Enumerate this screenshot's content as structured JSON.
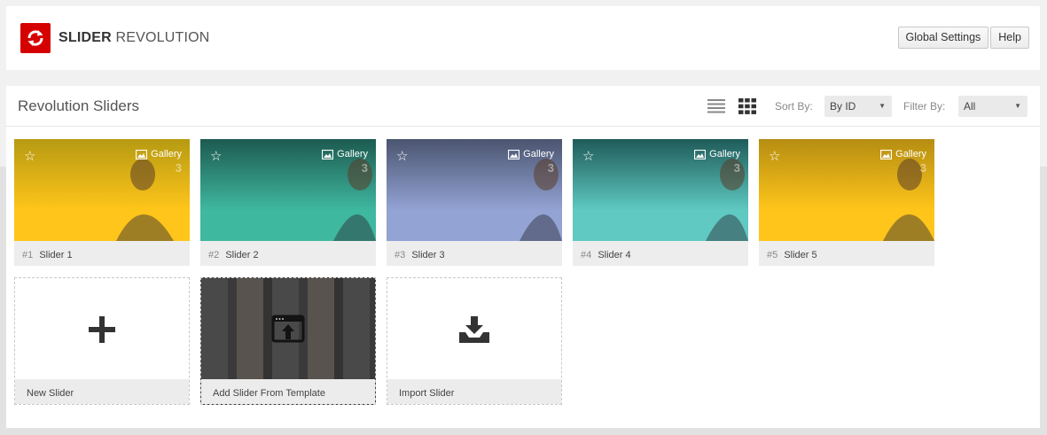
{
  "app": {
    "logo_bold": "SLIDER",
    "logo_light": "REVOLUTION"
  },
  "header": {
    "global_settings_label": "Global Settings",
    "help_label": "Help"
  },
  "panel": {
    "title": "Revolution Sliders",
    "sort_label": "Sort By:",
    "sort_value": "By ID",
    "filter_label": "Filter By:",
    "filter_value": "All"
  },
  "sliders": [
    {
      "num": "#1",
      "name": "Slider 1",
      "type": "Gallery",
      "count": "3",
      "bg_top": "#b69a12",
      "bg_bottom": "#ffc51a"
    },
    {
      "num": "#2",
      "name": "Slider 2",
      "type": "Gallery",
      "count": "3",
      "bg_top": "#1d5a50",
      "bg_bottom": "#3fb8a0"
    },
    {
      "num": "#3",
      "name": "Slider 3",
      "type": "Gallery",
      "count": "3",
      "bg_top": "#4b5570",
      "bg_bottom": "#93a3d4"
    },
    {
      "num": "#4",
      "name": "Slider 4",
      "type": "Gallery",
      "count": "3",
      "bg_top": "#1f5b59",
      "bg_bottom": "#5fc9c2"
    },
    {
      "num": "#5",
      "name": "Slider 5",
      "type": "Gallery",
      "count": "3",
      "bg_top": "#b58d12",
      "bg_bottom": "#ffc51a"
    }
  ],
  "actions": {
    "new_slider": "New Slider",
    "add_from_template": "Add Slider From Template",
    "import_slider": "Import Slider"
  },
  "colors": {
    "brand_red": "#d50000"
  }
}
